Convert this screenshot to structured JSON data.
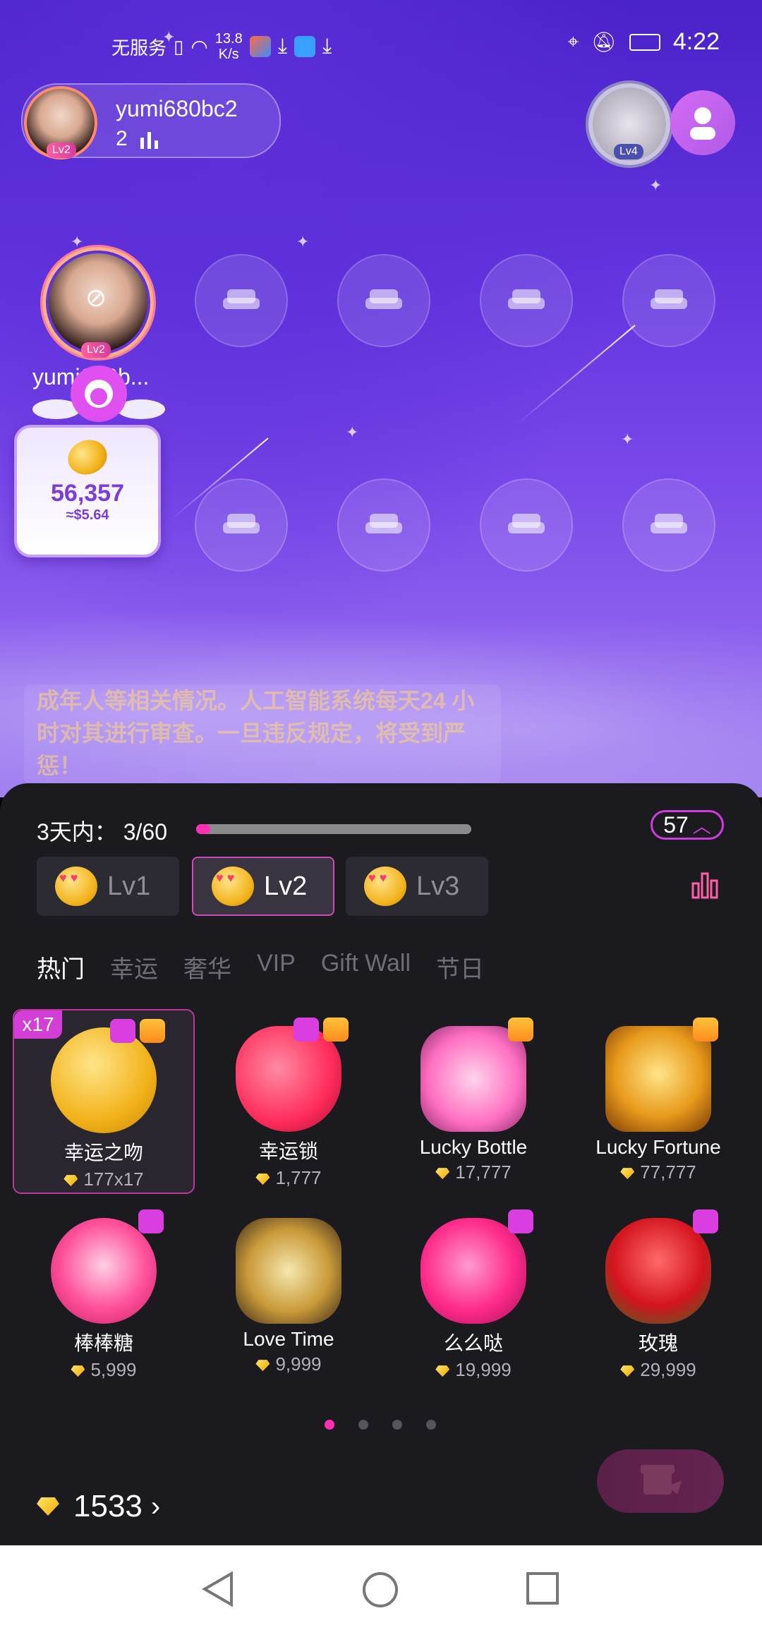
{
  "status_bar": {
    "carrier": "无服务",
    "net_speed_value": "13.8",
    "net_speed_unit": "K/s",
    "time": "4:22"
  },
  "header": {
    "host_name": "yumi680bc2",
    "host_level": "Lv2",
    "listener_count": "2",
    "room_badge_level": "Lv4"
  },
  "seat_host": {
    "name": "yumi680b...",
    "level": "Lv2"
  },
  "coin_card": {
    "amount": "56,357",
    "usd": "≈$5.64"
  },
  "notice_text": "成年人等相关情况。人工智能系统每天24 小时对其进行审查。一旦违反规定，将受到严惩！",
  "gift_panel": {
    "progress_label": "3天内：",
    "progress_value": "3/60",
    "progress_fraction": 0.05,
    "level_badge": "57",
    "level_tabs": [
      {
        "label": "Lv1",
        "active": false
      },
      {
        "label": "Lv2",
        "active": true
      },
      {
        "label": "Lv3",
        "active": false
      }
    ],
    "categories": [
      "热门",
      "幸运",
      "奢华",
      "VIP",
      "Gift Wall",
      "节日"
    ],
    "active_category": "热门",
    "gifts": [
      {
        "name": "幸运之吻",
        "price": "177x17",
        "badge": "x17"
      },
      {
        "name": "幸运锁",
        "price": "1,777"
      },
      {
        "name": "Lucky Bottle",
        "price": "17,777"
      },
      {
        "name": "Lucky Fortune",
        "price": "77,777"
      },
      {
        "name": "棒棒糖",
        "price": "5,999"
      },
      {
        "name": "Love Time",
        "price": "9,999"
      },
      {
        "name": "么么哒",
        "price": "19,999"
      },
      {
        "name": "玫瑰",
        "price": "29,999"
      }
    ],
    "page_count": 4,
    "active_page": 1,
    "balance": "1533",
    "colors": {
      "accent": "#ff2fb5",
      "sheet_bg": "#1b1a1f"
    }
  }
}
